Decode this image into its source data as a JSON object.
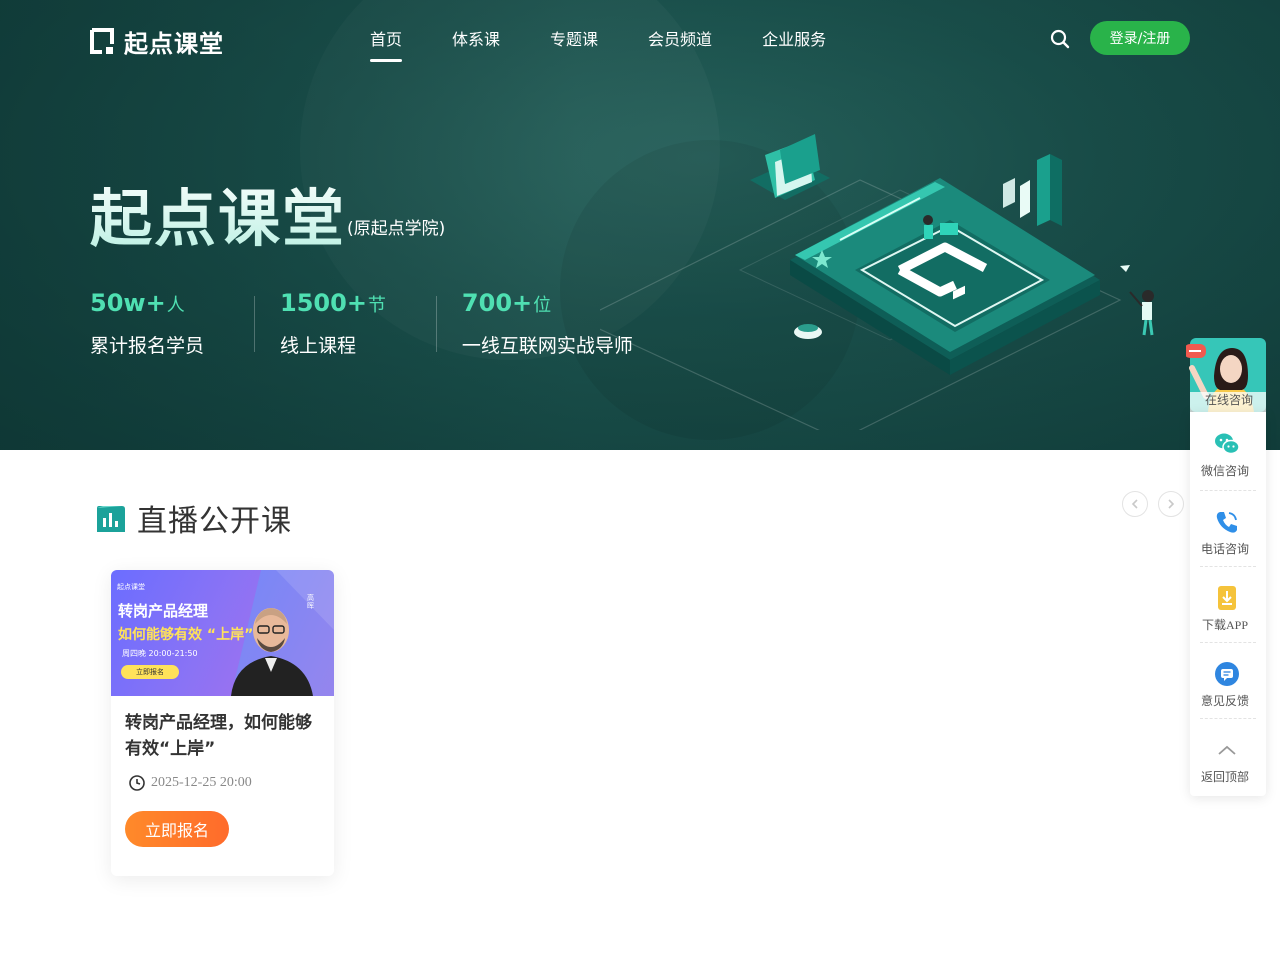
{
  "header": {
    "logo_text": "起点课堂",
    "nav": [
      {
        "label": "首页",
        "active": true
      },
      {
        "label": "体系课"
      },
      {
        "label": "专题课"
      },
      {
        "label": "会员频道"
      },
      {
        "label": "企业服务"
      }
    ],
    "login_label": "登录/注册",
    "accent_color": "#29b34a"
  },
  "hero": {
    "title": "起点课堂",
    "subtitle": "(原起点学院)",
    "stats": [
      {
        "number": "50w+",
        "unit": "人",
        "label": "累计报名学员"
      },
      {
        "number": "1500+",
        "unit": "节",
        "label": "线上课程"
      },
      {
        "number": "700+",
        "unit": "位",
        "label": "一线互联网实战导师"
      }
    ]
  },
  "section": {
    "title": "直播公开课"
  },
  "course": {
    "banner_top": "起点课堂",
    "banner_line1": "转岗产品经理",
    "banner_line2": "如何能够有效 “上岸”",
    "banner_time": "周四晚 20:00-21:50",
    "banner_button": "立即报名",
    "banner_side": "高晖",
    "title": "转岗产品经理，如何能够有效“上岸”",
    "datetime": "2025-12-25 20:00",
    "signup_label": "立即报名",
    "signup_color": "#ff7a2a"
  },
  "sidebar": {
    "consult_label": "在线咨询",
    "items": [
      {
        "label": "微信咨询",
        "icon": "wechat-icon"
      },
      {
        "label": "电话咨询",
        "icon": "phone-icon"
      },
      {
        "label": "下载APP",
        "icon": "download-icon"
      },
      {
        "label": "意见反馈",
        "icon": "feedback-icon"
      },
      {
        "label": "返回顶部",
        "icon": "arrow-up-icon"
      }
    ]
  }
}
